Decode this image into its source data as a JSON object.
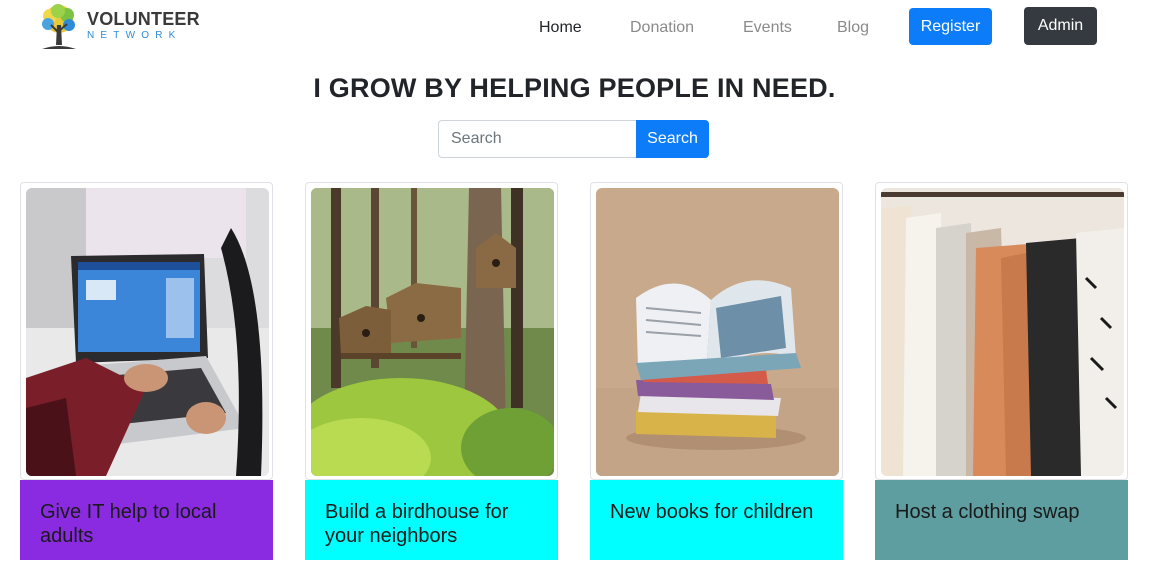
{
  "brand": {
    "title": "VOLUNTEER",
    "subtitle": "NETWORK",
    "logo_icon": "tree-icon"
  },
  "nav": {
    "items": [
      {
        "label": "Home",
        "active": true
      },
      {
        "label": "Donation",
        "active": false
      },
      {
        "label": "Events",
        "active": false
      },
      {
        "label": "Blog",
        "active": false
      }
    ],
    "register_label": "Register",
    "admin_label": "Admin"
  },
  "hero": {
    "headline": "I GROW BY HELPING PEOPLE IN NEED."
  },
  "search": {
    "placeholder": "Search",
    "button_label": "Search"
  },
  "cards": [
    {
      "title": "Give IT help to local adults",
      "color": "#8a2be2",
      "image": "laptop-typing-photo"
    },
    {
      "title": "Build a birdhouse for your neighbors",
      "color": "#00ffff",
      "image": "birdhouse-tree-photo"
    },
    {
      "title": "New books for children",
      "color": "#00ffff",
      "image": "books-stack-photo"
    },
    {
      "title": "Host a clothing swap",
      "color": "#5f9ea0",
      "image": "clothes-rack-photo"
    }
  ]
}
